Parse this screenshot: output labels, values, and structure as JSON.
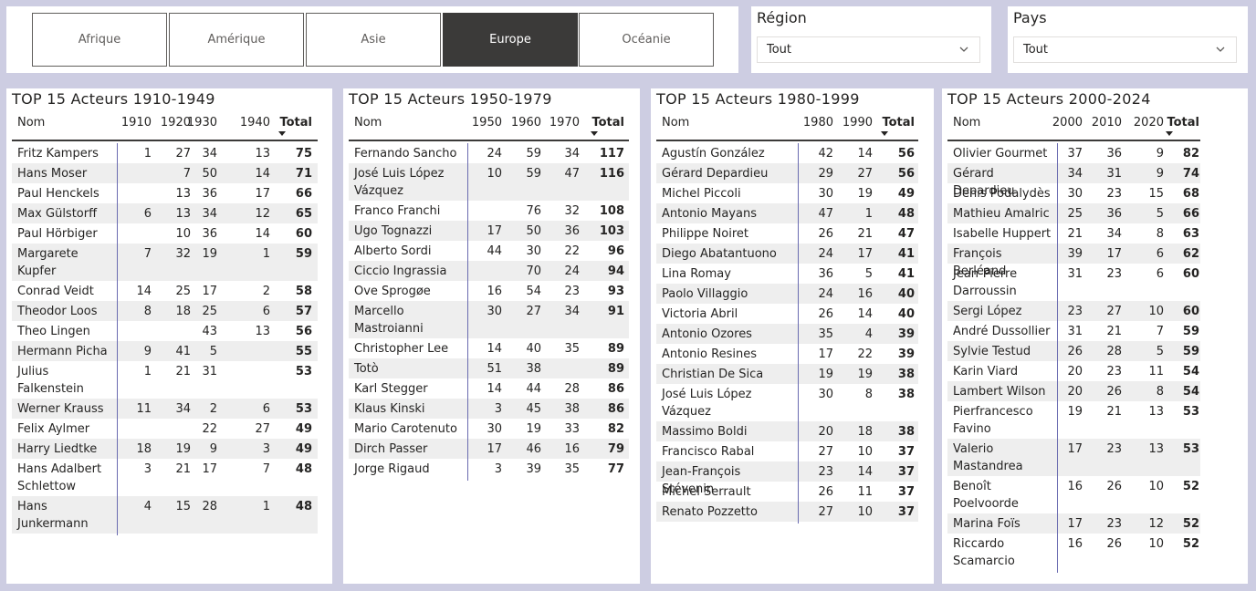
{
  "continents": [
    "Afrique",
    "Amérique",
    "Asie",
    "Europe",
    "Océanie"
  ],
  "active_continent": "Europe",
  "slicers": {
    "region": {
      "title": "Région",
      "value": "Tout"
    },
    "pays": {
      "title": "Pays",
      "value": "Tout"
    }
  },
  "tables": [
    {
      "title": "TOP 15 Acteurs 1910-1949",
      "columns": [
        "Nom",
        "1910",
        "1920",
        "1930",
        "1940",
        "Total"
      ],
      "rows": [
        {
          "name": "Fritz Kampers",
          "vals": [
            "1",
            "27",
            "34",
            "13"
          ],
          "total": "75"
        },
        {
          "name": "Hans Moser",
          "vals": [
            "",
            "7",
            "50",
            "14"
          ],
          "total": "71"
        },
        {
          "name": "Paul Henckels",
          "vals": [
            "",
            "13",
            "36",
            "17"
          ],
          "total": "66"
        },
        {
          "name": "Max Gülstorff",
          "vals": [
            "6",
            "13",
            "34",
            "12"
          ],
          "total": "65"
        },
        {
          "name": "Paul Hörbiger",
          "vals": [
            "",
            "10",
            "36",
            "14"
          ],
          "total": "60"
        },
        {
          "name": "Margarete Kupfer",
          "lines": [
            "Margarete",
            "Kupfer"
          ],
          "vals": [
            "7",
            "32",
            "19",
            "1"
          ],
          "total": "59"
        },
        {
          "name": "Conrad Veidt",
          "vals": [
            "14",
            "25",
            "17",
            "2"
          ],
          "total": "58"
        },
        {
          "name": "Theodor Loos",
          "vals": [
            "8",
            "18",
            "25",
            "6"
          ],
          "total": "57"
        },
        {
          "name": "Theo Lingen",
          "vals": [
            "",
            "",
            "43",
            "13"
          ],
          "total": "56"
        },
        {
          "name": "Hermann Picha",
          "vals": [
            "9",
            "41",
            "5",
            ""
          ],
          "total": "55"
        },
        {
          "name": "Julius Falkenstein",
          "lines": [
            "Julius",
            "Falkenstein"
          ],
          "vals": [
            "1",
            "21",
            "31",
            ""
          ],
          "total": "53"
        },
        {
          "name": "Werner Krauss",
          "vals": [
            "11",
            "34",
            "2",
            "6"
          ],
          "total": "53"
        },
        {
          "name": "Felix Aylmer",
          "vals": [
            "",
            "",
            "22",
            "27"
          ],
          "total": "49"
        },
        {
          "name": "Harry Liedtke",
          "vals": [
            "18",
            "19",
            "9",
            "3"
          ],
          "total": "49"
        },
        {
          "name": "Hans Adalbert Schlettow",
          "lines": [
            "Hans Adalbert",
            "Schlettow"
          ],
          "vals": [
            "3",
            "21",
            "17",
            "7"
          ],
          "total": "48"
        },
        {
          "name": "Hans Junkermann",
          "lines": [
            "Hans",
            "Junkermann"
          ],
          "vals": [
            "4",
            "15",
            "28",
            "1"
          ],
          "total": "48"
        }
      ]
    },
    {
      "title": "TOP 15 Acteurs 1950-1979",
      "columns": [
        "Nom",
        "1950",
        "1960",
        "1970",
        "Total"
      ],
      "rows": [
        {
          "name": "Fernando Sancho",
          "vals": [
            "24",
            "59",
            "34"
          ],
          "total": "117"
        },
        {
          "name": "José Luis López Vázquez",
          "lines": [
            "José Luis López",
            "Vázquez"
          ],
          "vals": [
            "10",
            "59",
            "47"
          ],
          "total": "116"
        },
        {
          "name": "Franco Franchi",
          "vals": [
            "",
            "76",
            "32"
          ],
          "total": "108"
        },
        {
          "name": "Ugo Tognazzi",
          "vals": [
            "17",
            "50",
            "36"
          ],
          "total": "103"
        },
        {
          "name": "Alberto Sordi",
          "vals": [
            "44",
            "30",
            "22"
          ],
          "total": "96"
        },
        {
          "name": "Ciccio Ingrassia",
          "vals": [
            "",
            "70",
            "24"
          ],
          "total": "94"
        },
        {
          "name": "Ove Sprogøe",
          "vals": [
            "16",
            "54",
            "23"
          ],
          "total": "93"
        },
        {
          "name": "Marcello Mastroianni",
          "lines": [
            "Marcello",
            "Mastroianni"
          ],
          "vals": [
            "30",
            "27",
            "34"
          ],
          "total": "91"
        },
        {
          "name": "Christopher Lee",
          "vals": [
            "14",
            "40",
            "35"
          ],
          "total": "89"
        },
        {
          "name": "Totò",
          "vals": [
            "51",
            "38",
            ""
          ],
          "total": "89"
        },
        {
          "name": "Karl Stegger",
          "vals": [
            "14",
            "44",
            "28"
          ],
          "total": "86"
        },
        {
          "name": "Klaus Kinski",
          "vals": [
            "3",
            "45",
            "38"
          ],
          "total": "86"
        },
        {
          "name": "Mario Carotenuto",
          "vals": [
            "30",
            "19",
            "33"
          ],
          "total": "82"
        },
        {
          "name": "Dirch Passer",
          "vals": [
            "17",
            "46",
            "16"
          ],
          "total": "79"
        },
        {
          "name": "Jorge Rigaud",
          "vals": [
            "3",
            "39",
            "35"
          ],
          "total": "77"
        }
      ]
    },
    {
      "title": "TOP 15 Acteurs 1980-1999",
      "columns": [
        "Nom",
        "1980",
        "1990",
        "Total"
      ],
      "rows": [
        {
          "name": "Agustín González",
          "vals": [
            "42",
            "14"
          ],
          "total": "56"
        },
        {
          "name": "Gérard Depardieu",
          "vals": [
            "29",
            "27"
          ],
          "total": "56"
        },
        {
          "name": "Michel Piccoli",
          "vals": [
            "30",
            "19"
          ],
          "total": "49"
        },
        {
          "name": "Antonio Mayans",
          "vals": [
            "47",
            "1"
          ],
          "total": "48"
        },
        {
          "name": "Philippe Noiret",
          "vals": [
            "26",
            "21"
          ],
          "total": "47"
        },
        {
          "name": "Diego Abatantuono",
          "vals": [
            "24",
            "17"
          ],
          "total": "41"
        },
        {
          "name": "Lina Romay",
          "vals": [
            "36",
            "5"
          ],
          "total": "41"
        },
        {
          "name": "Paolo Villaggio",
          "vals": [
            "24",
            "16"
          ],
          "total": "40"
        },
        {
          "name": "Victoria Abril",
          "vals": [
            "26",
            "14"
          ],
          "total": "40"
        },
        {
          "name": "Antonio Ozores",
          "vals": [
            "35",
            "4"
          ],
          "total": "39"
        },
        {
          "name": "Antonio Resines",
          "vals": [
            "17",
            "22"
          ],
          "total": "39"
        },
        {
          "name": "Christian De Sica",
          "vals": [
            "19",
            "19"
          ],
          "total": "38"
        },
        {
          "name": "José Luis López Vázquez",
          "lines": [
            "José Luis López",
            "Vázquez"
          ],
          "vals": [
            "30",
            "8"
          ],
          "total": "38"
        },
        {
          "name": "Massimo Boldi",
          "vals": [
            "20",
            "18"
          ],
          "total": "38"
        },
        {
          "name": "Francisco Rabal",
          "vals": [
            "27",
            "10"
          ],
          "total": "37"
        },
        {
          "name": "Jean-François Stévenin",
          "vals": [
            "23",
            "14"
          ],
          "total": "37"
        },
        {
          "name": "Michel Serrault",
          "vals": [
            "26",
            "11"
          ],
          "total": "37"
        },
        {
          "name": "Renato Pozzetto",
          "vals": [
            "27",
            "10"
          ],
          "total": "37"
        }
      ]
    },
    {
      "title": "TOP 15 Acteurs 2000-2024",
      "columns": [
        "Nom",
        "2000",
        "2010",
        "2020",
        "Total"
      ],
      "rows": [
        {
          "name": "Olivier Gourmet",
          "vals": [
            "37",
            "36",
            "9"
          ],
          "total": "82"
        },
        {
          "name": "Gérard Depardieu",
          "vals": [
            "34",
            "31",
            "9"
          ],
          "total": "74"
        },
        {
          "name": "Denis Podalydès",
          "vals": [
            "30",
            "23",
            "15"
          ],
          "total": "68"
        },
        {
          "name": "Mathieu Amalric",
          "vals": [
            "25",
            "36",
            "5"
          ],
          "total": "66"
        },
        {
          "name": "Isabelle Huppert",
          "vals": [
            "21",
            "34",
            "8"
          ],
          "total": "63"
        },
        {
          "name": "François Berléand",
          "vals": [
            "39",
            "17",
            "6"
          ],
          "total": "62"
        },
        {
          "name": "Jean-Pierre Darroussin",
          "lines": [
            "Jean-Pierre",
            "Darroussin"
          ],
          "vals": [
            "31",
            "23",
            "6"
          ],
          "total": "60"
        },
        {
          "name": "Sergi López",
          "vals": [
            "23",
            "27",
            "10"
          ],
          "total": "60"
        },
        {
          "name": "André Dussollier",
          "vals": [
            "31",
            "21",
            "7"
          ],
          "total": "59"
        },
        {
          "name": "Sylvie Testud",
          "vals": [
            "26",
            "28",
            "5"
          ],
          "total": "59"
        },
        {
          "name": "Karin Viard",
          "vals": [
            "20",
            "23",
            "11"
          ],
          "total": "54"
        },
        {
          "name": "Lambert Wilson",
          "vals": [
            "20",
            "26",
            "8"
          ],
          "total": "54"
        },
        {
          "name": "Pierfrancesco Favino",
          "lines": [
            "Pierfrancesco",
            "Favino"
          ],
          "vals": [
            "19",
            "21",
            "13"
          ],
          "total": "53"
        },
        {
          "name": "Valerio Mastandrea",
          "lines": [
            "Valerio",
            "Mastandrea"
          ],
          "vals": [
            "17",
            "23",
            "13"
          ],
          "total": "53"
        },
        {
          "name": "Benoît Poelvoorde",
          "lines": [
            "Benoît",
            "Poelvoorde"
          ],
          "vals": [
            "16",
            "26",
            "10"
          ],
          "total": "52"
        },
        {
          "name": "Marina Foïs",
          "vals": [
            "17",
            "23",
            "12"
          ],
          "total": "52"
        },
        {
          "name": "Riccardo Scamarcio",
          "lines": [
            "Riccardo",
            "Scamarcio"
          ],
          "vals": [
            "16",
            "26",
            "10"
          ],
          "total": "52"
        }
      ]
    }
  ]
}
